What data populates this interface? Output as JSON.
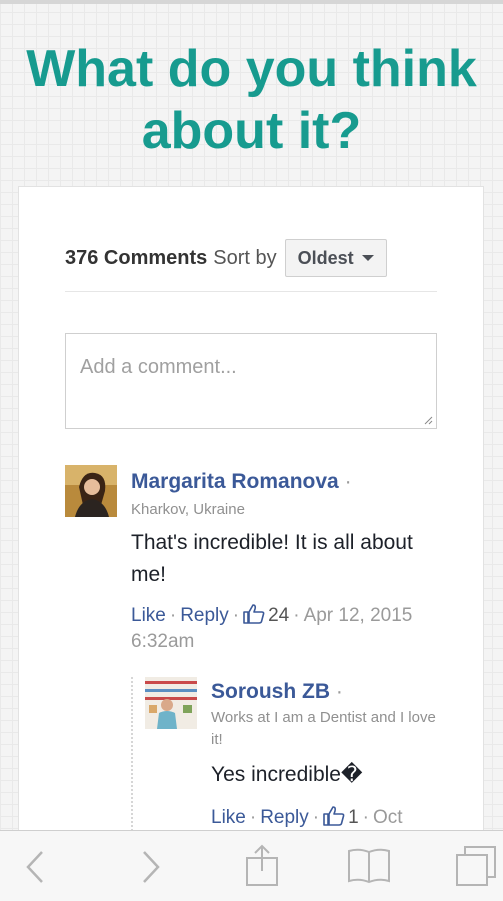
{
  "headline": "What do you think about it?",
  "comments_header": {
    "count_label": "376 Comments",
    "sort_label": "Sort by",
    "sort_value": "Oldest"
  },
  "comment_input": {
    "placeholder": "Add a comment..."
  },
  "comments": [
    {
      "author": "Margarita Romanova",
      "meta": "Kharkov, Ukraine",
      "text": "That's incredible! It is all about me!",
      "like_label": "Like",
      "reply_label": "Reply",
      "like_count": "24",
      "timestamp": "Apr 12, 2015 6:32am"
    },
    {
      "author": "Soroush ZB",
      "meta": "Works at I am a Dentist and I love it!",
      "text": "Yes incredible�",
      "like_label": "Like",
      "reply_label": "Reply",
      "like_count": "1",
      "timestamp": "Oct"
    }
  ],
  "toolbar_icons": [
    "back-icon",
    "forward-icon",
    "share-icon",
    "bookmarks-icon",
    "tabs-icon"
  ],
  "colors": {
    "accent": "#179b8f",
    "link": "#3b5998",
    "like_blue": "#3b5998"
  }
}
